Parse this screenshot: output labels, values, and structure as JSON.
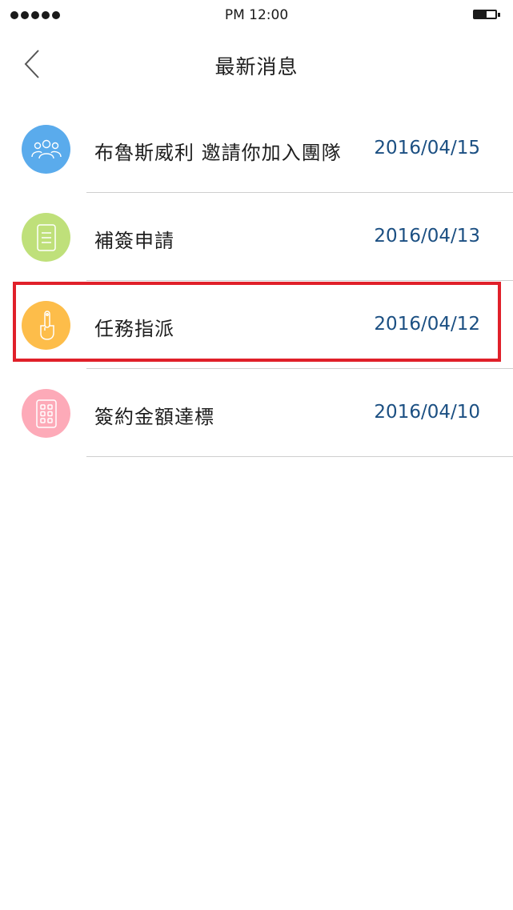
{
  "status_bar": {
    "time": "PM 12:00",
    "signal_dots": 5
  },
  "nav": {
    "title": "最新消息",
    "back_icon": "chevron-left-icon"
  },
  "messages": [
    {
      "label": "布魯斯威利 邀請你加入團隊",
      "date": "2016/04/15",
      "icon": "group-icon",
      "color": "#5aabec"
    },
    {
      "label": "補簽申請",
      "date": "2016/04/13",
      "icon": "document-icon",
      "color": "#bfe07a"
    },
    {
      "label": "任務指派",
      "date": "2016/04/12",
      "icon": "finger-tap-icon",
      "color": "#fdbd4a"
    },
    {
      "label": "簽約金額達標",
      "date": "2016/04/10",
      "icon": "grid-icon",
      "color": "#fdaab8"
    }
  ],
  "highlight_color": "#e0202a",
  "date_color": "#1b4f82"
}
